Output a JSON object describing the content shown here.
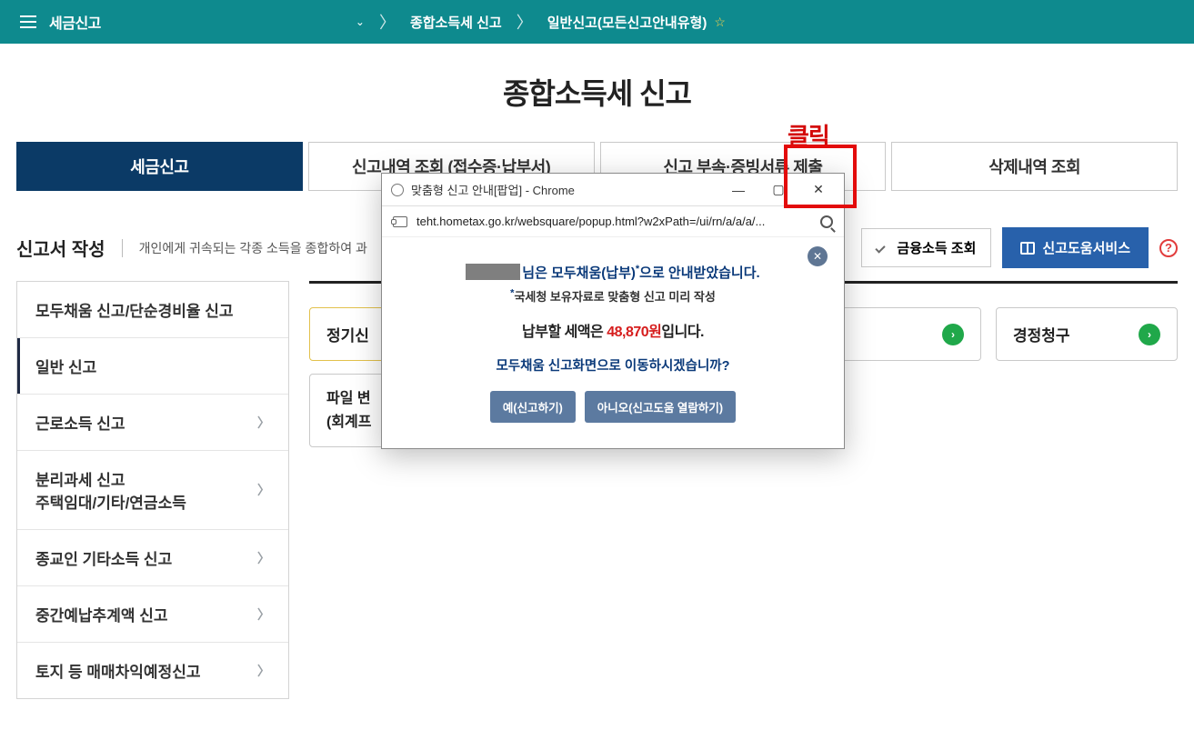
{
  "topbar": {
    "menu_label": "세금신고",
    "crumb1": "종합소득세 신고",
    "crumb2": "일반신고(모든신고안내유형)"
  },
  "page_title": "종합소득세 신고",
  "annotation": "클릭",
  "tabs": [
    "세금신고",
    "신고내역 조회 (접수증·납부서)",
    "신고 부속·증빙서류 제출",
    "삭제내역 조회"
  ],
  "doc_heading": "신고서 작성",
  "doc_sub": "개인에게 귀속되는 각종 소득을 종합하여 과",
  "actions": {
    "finance_lookup": "금융소득 조회",
    "help_service": "신고도움서비스"
  },
  "side_items": [
    "모두채움 신고/단순경비율 신고",
    "일반 신고",
    "근로소득 신고",
    "분리과세 신고\n주택임대/기타/연금소득",
    "종교인 기타소득 신고",
    "중간예납추계액 신고",
    "토지 등 매매차익예정신고"
  ],
  "cards": {
    "left_partial": "정기신",
    "right": "경정청구",
    "file_partial_1": "파일 변",
    "file_partial_2": "(회계프"
  },
  "popup": {
    "window_title": "맞춤형 신고 안내[팝업] - Chrome",
    "url": "teht.hometax.go.kr/websquare/popup.html?w2xPath=/ui/rn/a/a/a/...",
    "line1_prefix": "님은 ",
    "line1_strong": "모두채움(납부)",
    "line1_suffix": "으로 안내받았습니다.",
    "line2": "국세청 보유자료로 맞춤형 신고 미리 작성",
    "line3_prefix": "납부할 세액은 ",
    "amount": "48,870원",
    "line3_suffix": "입니다.",
    "line4": "모두채움 신고화면으로 이동하시겠습니까?",
    "btn_yes": "예(신고하기)",
    "btn_no": "아니오(신고도움 열람하기)"
  }
}
